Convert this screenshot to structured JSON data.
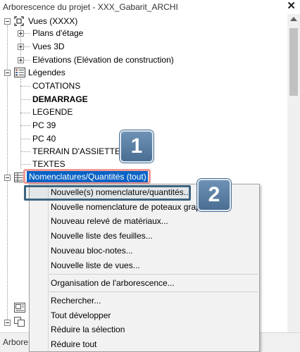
{
  "window": {
    "title": "Arborescence du projet - XXX_Gabarit_ARCHI",
    "close_glyph": "✕"
  },
  "tree": {
    "views": {
      "label": "Vues (XXXX)",
      "children": [
        "Plans d'étage",
        "Vues 3D",
        "Elévations (Elévation de construction)"
      ]
    },
    "legends": {
      "label": "Légendes",
      "children": [
        "COTATIONS",
        "DEMARRAGE",
        "LEGENDE",
        "PC 39",
        "PC 40",
        "TERRAIN D'ASSIETTE",
        "TEXTES"
      ]
    },
    "schedules": {
      "label": "Nomenclatures/Quantités (tout)"
    }
  },
  "context_menu": {
    "items": [
      "Nouvelle(s) nomenclature/quantités...",
      "Nouvelle nomenclature de poteaux graphique...",
      "Nouveau relevé de matériaux...",
      "Nouvelle liste des feuilles...",
      "Nouveau bloc-notes...",
      "Nouvelle liste de vues...",
      "Organisation de l'arborescence...",
      "Rechercher...",
      "Tout développer",
      "Réduire la sélection",
      "Réduire tout"
    ]
  },
  "callouts": {
    "one": "1",
    "two": "2"
  },
  "statusbar": {
    "tab_label": "Arbore"
  },
  "colors": {
    "selection": "#0a63c5",
    "callout": "#5a7ea5",
    "highlight_red": "#f29a94",
    "highlight_dark": "#3d6480"
  }
}
